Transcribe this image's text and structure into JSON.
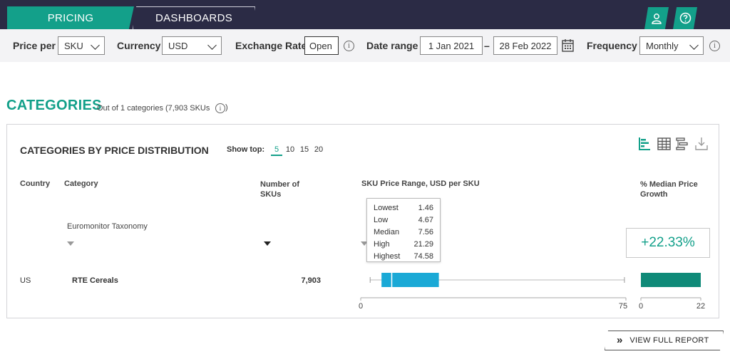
{
  "nav": {
    "tabs": [
      {
        "label": "PRICING"
      },
      {
        "label": "DASHBOARDS"
      }
    ],
    "icons": [
      "user-icon",
      "help-icon"
    ]
  },
  "filters": {
    "price_per_label": "Price per",
    "price_per_value": "SKU",
    "currency_label": "Currency",
    "currency_value": "USD",
    "exchange_rate_label": "Exchange Rate",
    "exchange_rate_value": "Open",
    "date_range_label": "Date range",
    "date_from": "1 Jan 2021",
    "date_separator": "–",
    "date_to": "28 Feb 2022",
    "frequency_label": "Frequency",
    "frequency_value": "Monthly",
    "info_glyph": "i"
  },
  "section": {
    "title": "CATEGORIES",
    "subtitle": "Out of 1 categories (7,903 SKUs"
  },
  "panel": {
    "title": "CATEGORIES BY PRICE DISTRIBUTION",
    "show_top_label": "Show top:",
    "show_top_options": [
      "5",
      "10",
      "15",
      "20"
    ],
    "show_top_selected": "5",
    "toolbar_icons": [
      "bar-chart-icon",
      "table-icon",
      "sort-icon",
      "download-icon"
    ],
    "columns": {
      "country": "Country",
      "category": "Category",
      "skus_line1": "Number of",
      "skus_line2": "SKUs",
      "price_range": "SKU Price Range, USD per SKU",
      "growth_line1": "% Median Price",
      "growth_line2": "Growth"
    },
    "taxonomy_label": "Euromonitor Taxonomy",
    "rows": [
      {
        "country": "US",
        "category": "RTE Cereals",
        "skus": "7,903"
      }
    ],
    "tooltip": [
      {
        "label": "Lowest",
        "value": "1.46"
      },
      {
        "label": "Low",
        "value": "4.67"
      },
      {
        "label": "Median",
        "value": "7.56"
      },
      {
        "label": "High",
        "value": "21.29"
      },
      {
        "label": "Highest",
        "value": "74.58"
      }
    ],
    "price_axis": {
      "min": 0,
      "max": 75,
      "min_label": "0",
      "max_label": "75"
    },
    "box": {
      "lowest": 1.46,
      "low": 4.67,
      "median": 7.56,
      "high": 21.29,
      "highest": 74.58
    },
    "growth": {
      "value": 22.33,
      "label": "+22.33%",
      "axis_min": 0,
      "axis_max": 22,
      "min_label": "0",
      "max_label": "22"
    },
    "colors": {
      "box": "#1aa9d6",
      "growth_bar": "#0f8a78",
      "accent": "#13a08a"
    }
  },
  "footer": {
    "report_button": "VIEW FULL REPORT",
    "report_glyph": "»"
  }
}
